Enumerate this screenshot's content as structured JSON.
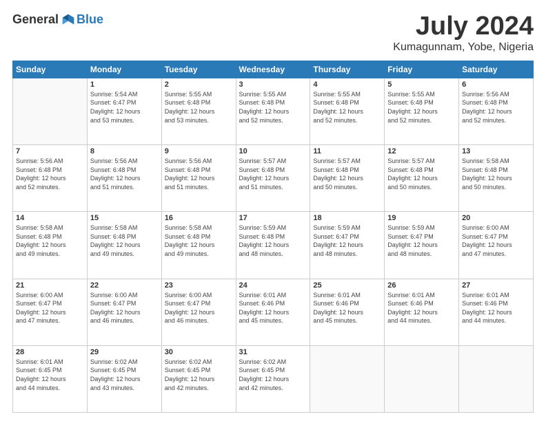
{
  "logo": {
    "general": "General",
    "blue": "Blue"
  },
  "header": {
    "month": "July 2024",
    "location": "Kumagunnam, Yobe, Nigeria"
  },
  "weekdays": [
    "Sunday",
    "Monday",
    "Tuesday",
    "Wednesday",
    "Thursday",
    "Friday",
    "Saturday"
  ],
  "weeks": [
    [
      {
        "day": "",
        "info": ""
      },
      {
        "day": "1",
        "info": "Sunrise: 5:54 AM\nSunset: 6:47 PM\nDaylight: 12 hours\nand 53 minutes."
      },
      {
        "day": "2",
        "info": "Sunrise: 5:55 AM\nSunset: 6:48 PM\nDaylight: 12 hours\nand 53 minutes."
      },
      {
        "day": "3",
        "info": "Sunrise: 5:55 AM\nSunset: 6:48 PM\nDaylight: 12 hours\nand 52 minutes."
      },
      {
        "day": "4",
        "info": "Sunrise: 5:55 AM\nSunset: 6:48 PM\nDaylight: 12 hours\nand 52 minutes."
      },
      {
        "day": "5",
        "info": "Sunrise: 5:55 AM\nSunset: 6:48 PM\nDaylight: 12 hours\nand 52 minutes."
      },
      {
        "day": "6",
        "info": "Sunrise: 5:56 AM\nSunset: 6:48 PM\nDaylight: 12 hours\nand 52 minutes."
      }
    ],
    [
      {
        "day": "7",
        "info": "Sunrise: 5:56 AM\nSunset: 6:48 PM\nDaylight: 12 hours\nand 52 minutes."
      },
      {
        "day": "8",
        "info": "Sunrise: 5:56 AM\nSunset: 6:48 PM\nDaylight: 12 hours\nand 51 minutes."
      },
      {
        "day": "9",
        "info": "Sunrise: 5:56 AM\nSunset: 6:48 PM\nDaylight: 12 hours\nand 51 minutes."
      },
      {
        "day": "10",
        "info": "Sunrise: 5:57 AM\nSunset: 6:48 PM\nDaylight: 12 hours\nand 51 minutes."
      },
      {
        "day": "11",
        "info": "Sunrise: 5:57 AM\nSunset: 6:48 PM\nDaylight: 12 hours\nand 50 minutes."
      },
      {
        "day": "12",
        "info": "Sunrise: 5:57 AM\nSunset: 6:48 PM\nDaylight: 12 hours\nand 50 minutes."
      },
      {
        "day": "13",
        "info": "Sunrise: 5:58 AM\nSunset: 6:48 PM\nDaylight: 12 hours\nand 50 minutes."
      }
    ],
    [
      {
        "day": "14",
        "info": "Sunrise: 5:58 AM\nSunset: 6:48 PM\nDaylight: 12 hours\nand 49 minutes."
      },
      {
        "day": "15",
        "info": "Sunrise: 5:58 AM\nSunset: 6:48 PM\nDaylight: 12 hours\nand 49 minutes."
      },
      {
        "day": "16",
        "info": "Sunrise: 5:58 AM\nSunset: 6:48 PM\nDaylight: 12 hours\nand 49 minutes."
      },
      {
        "day": "17",
        "info": "Sunrise: 5:59 AM\nSunset: 6:48 PM\nDaylight: 12 hours\nand 48 minutes."
      },
      {
        "day": "18",
        "info": "Sunrise: 5:59 AM\nSunset: 6:47 PM\nDaylight: 12 hours\nand 48 minutes."
      },
      {
        "day": "19",
        "info": "Sunrise: 5:59 AM\nSunset: 6:47 PM\nDaylight: 12 hours\nand 48 minutes."
      },
      {
        "day": "20",
        "info": "Sunrise: 6:00 AM\nSunset: 6:47 PM\nDaylight: 12 hours\nand 47 minutes."
      }
    ],
    [
      {
        "day": "21",
        "info": "Sunrise: 6:00 AM\nSunset: 6:47 PM\nDaylight: 12 hours\nand 47 minutes."
      },
      {
        "day": "22",
        "info": "Sunrise: 6:00 AM\nSunset: 6:47 PM\nDaylight: 12 hours\nand 46 minutes."
      },
      {
        "day": "23",
        "info": "Sunrise: 6:00 AM\nSunset: 6:47 PM\nDaylight: 12 hours\nand 46 minutes."
      },
      {
        "day": "24",
        "info": "Sunrise: 6:01 AM\nSunset: 6:46 PM\nDaylight: 12 hours\nand 45 minutes."
      },
      {
        "day": "25",
        "info": "Sunrise: 6:01 AM\nSunset: 6:46 PM\nDaylight: 12 hours\nand 45 minutes."
      },
      {
        "day": "26",
        "info": "Sunrise: 6:01 AM\nSunset: 6:46 PM\nDaylight: 12 hours\nand 44 minutes."
      },
      {
        "day": "27",
        "info": "Sunrise: 6:01 AM\nSunset: 6:46 PM\nDaylight: 12 hours\nand 44 minutes."
      }
    ],
    [
      {
        "day": "28",
        "info": "Sunrise: 6:01 AM\nSunset: 6:45 PM\nDaylight: 12 hours\nand 44 minutes."
      },
      {
        "day": "29",
        "info": "Sunrise: 6:02 AM\nSunset: 6:45 PM\nDaylight: 12 hours\nand 43 minutes."
      },
      {
        "day": "30",
        "info": "Sunrise: 6:02 AM\nSunset: 6:45 PM\nDaylight: 12 hours\nand 42 minutes."
      },
      {
        "day": "31",
        "info": "Sunrise: 6:02 AM\nSunset: 6:45 PM\nDaylight: 12 hours\nand 42 minutes."
      },
      {
        "day": "",
        "info": ""
      },
      {
        "day": "",
        "info": ""
      },
      {
        "day": "",
        "info": ""
      }
    ]
  ]
}
